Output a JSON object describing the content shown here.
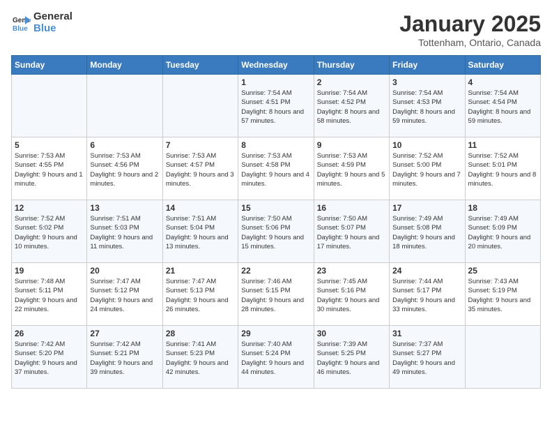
{
  "header": {
    "logo_line1": "General",
    "logo_line2": "Blue",
    "month": "January 2025",
    "location": "Tottenham, Ontario, Canada"
  },
  "weekdays": [
    "Sunday",
    "Monday",
    "Tuesday",
    "Wednesday",
    "Thursday",
    "Friday",
    "Saturday"
  ],
  "weeks": [
    [
      {
        "day": "",
        "info": ""
      },
      {
        "day": "",
        "info": ""
      },
      {
        "day": "",
        "info": ""
      },
      {
        "day": "1",
        "info": "Sunrise: 7:54 AM\nSunset: 4:51 PM\nDaylight: 8 hours and 57 minutes."
      },
      {
        "day": "2",
        "info": "Sunrise: 7:54 AM\nSunset: 4:52 PM\nDaylight: 8 hours and 58 minutes."
      },
      {
        "day": "3",
        "info": "Sunrise: 7:54 AM\nSunset: 4:53 PM\nDaylight: 8 hours and 59 minutes."
      },
      {
        "day": "4",
        "info": "Sunrise: 7:54 AM\nSunset: 4:54 PM\nDaylight: 8 hours and 59 minutes."
      }
    ],
    [
      {
        "day": "5",
        "info": "Sunrise: 7:53 AM\nSunset: 4:55 PM\nDaylight: 9 hours and 1 minute."
      },
      {
        "day": "6",
        "info": "Sunrise: 7:53 AM\nSunset: 4:56 PM\nDaylight: 9 hours and 2 minutes."
      },
      {
        "day": "7",
        "info": "Sunrise: 7:53 AM\nSunset: 4:57 PM\nDaylight: 9 hours and 3 minutes."
      },
      {
        "day": "8",
        "info": "Sunrise: 7:53 AM\nSunset: 4:58 PM\nDaylight: 9 hours and 4 minutes."
      },
      {
        "day": "9",
        "info": "Sunrise: 7:53 AM\nSunset: 4:59 PM\nDaylight: 9 hours and 5 minutes."
      },
      {
        "day": "10",
        "info": "Sunrise: 7:52 AM\nSunset: 5:00 PM\nDaylight: 9 hours and 7 minutes."
      },
      {
        "day": "11",
        "info": "Sunrise: 7:52 AM\nSunset: 5:01 PM\nDaylight: 9 hours and 8 minutes."
      }
    ],
    [
      {
        "day": "12",
        "info": "Sunrise: 7:52 AM\nSunset: 5:02 PM\nDaylight: 9 hours and 10 minutes."
      },
      {
        "day": "13",
        "info": "Sunrise: 7:51 AM\nSunset: 5:03 PM\nDaylight: 9 hours and 11 minutes."
      },
      {
        "day": "14",
        "info": "Sunrise: 7:51 AM\nSunset: 5:04 PM\nDaylight: 9 hours and 13 minutes."
      },
      {
        "day": "15",
        "info": "Sunrise: 7:50 AM\nSunset: 5:06 PM\nDaylight: 9 hours and 15 minutes."
      },
      {
        "day": "16",
        "info": "Sunrise: 7:50 AM\nSunset: 5:07 PM\nDaylight: 9 hours and 17 minutes."
      },
      {
        "day": "17",
        "info": "Sunrise: 7:49 AM\nSunset: 5:08 PM\nDaylight: 9 hours and 18 minutes."
      },
      {
        "day": "18",
        "info": "Sunrise: 7:49 AM\nSunset: 5:09 PM\nDaylight: 9 hours and 20 minutes."
      }
    ],
    [
      {
        "day": "19",
        "info": "Sunrise: 7:48 AM\nSunset: 5:11 PM\nDaylight: 9 hours and 22 minutes."
      },
      {
        "day": "20",
        "info": "Sunrise: 7:47 AM\nSunset: 5:12 PM\nDaylight: 9 hours and 24 minutes."
      },
      {
        "day": "21",
        "info": "Sunrise: 7:47 AM\nSunset: 5:13 PM\nDaylight: 9 hours and 26 minutes."
      },
      {
        "day": "22",
        "info": "Sunrise: 7:46 AM\nSunset: 5:15 PM\nDaylight: 9 hours and 28 minutes."
      },
      {
        "day": "23",
        "info": "Sunrise: 7:45 AM\nSunset: 5:16 PM\nDaylight: 9 hours and 30 minutes."
      },
      {
        "day": "24",
        "info": "Sunrise: 7:44 AM\nSunset: 5:17 PM\nDaylight: 9 hours and 33 minutes."
      },
      {
        "day": "25",
        "info": "Sunrise: 7:43 AM\nSunset: 5:19 PM\nDaylight: 9 hours and 35 minutes."
      }
    ],
    [
      {
        "day": "26",
        "info": "Sunrise: 7:42 AM\nSunset: 5:20 PM\nDaylight: 9 hours and 37 minutes."
      },
      {
        "day": "27",
        "info": "Sunrise: 7:42 AM\nSunset: 5:21 PM\nDaylight: 9 hours and 39 minutes."
      },
      {
        "day": "28",
        "info": "Sunrise: 7:41 AM\nSunset: 5:23 PM\nDaylight: 9 hours and 42 minutes."
      },
      {
        "day": "29",
        "info": "Sunrise: 7:40 AM\nSunset: 5:24 PM\nDaylight: 9 hours and 44 minutes."
      },
      {
        "day": "30",
        "info": "Sunrise: 7:39 AM\nSunset: 5:25 PM\nDaylight: 9 hours and 46 minutes."
      },
      {
        "day": "31",
        "info": "Sunrise: 7:37 AM\nSunset: 5:27 PM\nDaylight: 9 hours and 49 minutes."
      },
      {
        "day": "",
        "info": ""
      }
    ]
  ]
}
